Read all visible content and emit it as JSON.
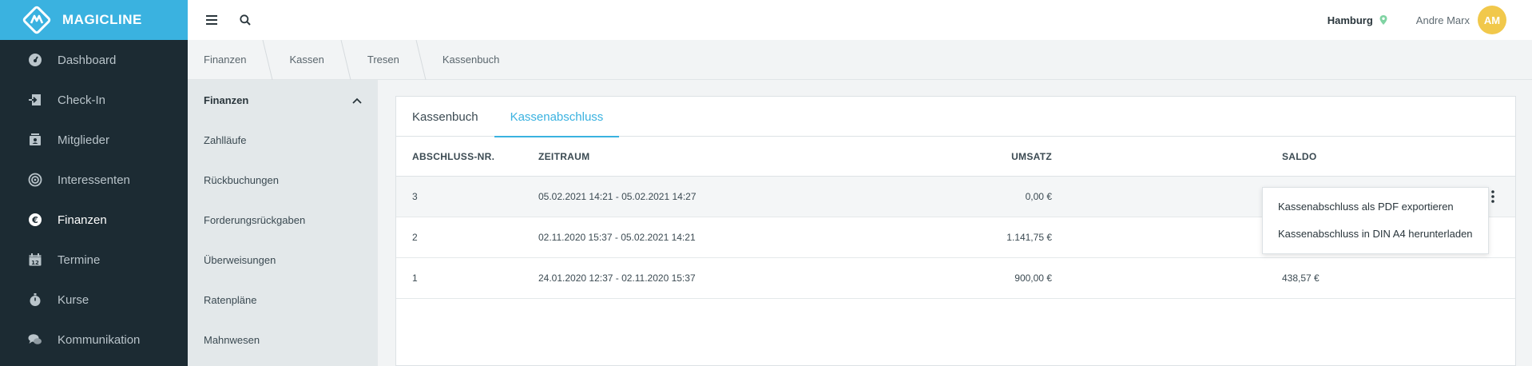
{
  "brand": {
    "name": "MAGICLINE",
    "color": "#3ab2e0"
  },
  "sidebar": {
    "items": [
      {
        "label": "Dashboard",
        "icon": "dashboard-gauge-icon"
      },
      {
        "label": "Check-In",
        "icon": "sign-in-icon"
      },
      {
        "label": "Mitglieder",
        "icon": "member-card-icon"
      },
      {
        "label": "Interessenten",
        "icon": "target-icon"
      },
      {
        "label": "Finanzen",
        "icon": "euro-icon",
        "active": true
      },
      {
        "label": "Termine",
        "icon": "calendar-icon"
      },
      {
        "label": "Kurse",
        "icon": "stopwatch-icon"
      },
      {
        "label": "Kommunikation",
        "icon": "chat-icon"
      }
    ]
  },
  "topbar": {
    "location": "Hamburg",
    "user_name": "Andre Marx",
    "user_initials": "AM"
  },
  "breadcrumb": [
    "Finanzen",
    "Kassen",
    "Tresen",
    "Kassenbuch"
  ],
  "subnav": {
    "header": "Finanzen",
    "items": [
      "Zahlläufe",
      "Rückbuchungen",
      "Forderungsrückgaben",
      "Überweisungen",
      "Ratenpläne",
      "Mahnwesen"
    ]
  },
  "tabs": [
    {
      "label": "Kassenbuch",
      "active": false
    },
    {
      "label": "Kassenabschluss",
      "active": true
    }
  ],
  "table": {
    "columns": [
      "ABSCHLUSS-NR.",
      "ZEITRAUM",
      "UMSATZ",
      "SALDO"
    ],
    "rows": [
      {
        "nr": "3",
        "zeitraum": "05.02.2021 14:21 - 05.02.2021 14:27",
        "umsatz": "0,00 €",
        "saldo": ""
      },
      {
        "nr": "2",
        "zeitraum": "02.11.2020 15:37 - 05.02.2021 14:21",
        "umsatz": "1.141,75 €",
        "saldo": ""
      },
      {
        "nr": "1",
        "zeitraum": "24.01.2020 12:37 - 02.11.2020 15:37",
        "umsatz": "900,00 €",
        "saldo": "438,57 €"
      }
    ]
  },
  "dropdown": {
    "items": [
      "Kassenabschluss als PDF exportieren",
      "Kassenabschluss in DIN A4 herunterladen"
    ]
  }
}
